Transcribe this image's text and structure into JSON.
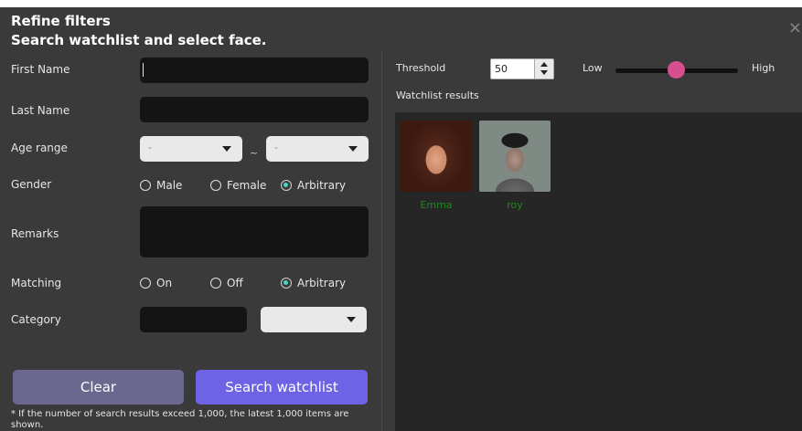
{
  "dialog": {
    "title_line1": "Refine filters",
    "title_line2": "Search watchlist and select face.",
    "close_glyph": "×"
  },
  "form": {
    "first_name_label": "First Name",
    "first_name_value": "",
    "last_name_label": "Last Name",
    "last_name_value": "",
    "age_range_label": "Age range",
    "age_from": "-",
    "age_separator": "~",
    "age_to": "-",
    "gender_label": "Gender",
    "gender_options": [
      "Male",
      "Female",
      "Arbitrary"
    ],
    "gender_selected": "Arbitrary",
    "remarks_label": "Remarks",
    "remarks_value": "",
    "matching_label": "Matching",
    "matching_options": [
      "On",
      "Off",
      "Arbitrary"
    ],
    "matching_selected": "Arbitrary",
    "category_label": "Category",
    "category_value": "",
    "category_select_value": ""
  },
  "buttons": {
    "clear": "Clear",
    "search": "Search watchlist"
  },
  "footnote": "* If the number of search results exceed 1,000, the latest 1,000 items are shown.",
  "threshold": {
    "label": "Threshold",
    "value": "50",
    "low_label": "Low",
    "high_label": "High",
    "slider_level": 0.5
  },
  "results": {
    "label": "Watchlist results",
    "items": [
      {
        "name": "Emma"
      },
      {
        "name": "roy"
      }
    ]
  },
  "colors": {
    "dialog_bg": "#3a3a3a",
    "results_bg": "#262626",
    "clear_button": "#6b6890",
    "search_button": "#6d63e4",
    "slider_thumb": "#d6508f",
    "radio_selected": "#4fd1c5",
    "result_name": "#1e8a1e"
  }
}
